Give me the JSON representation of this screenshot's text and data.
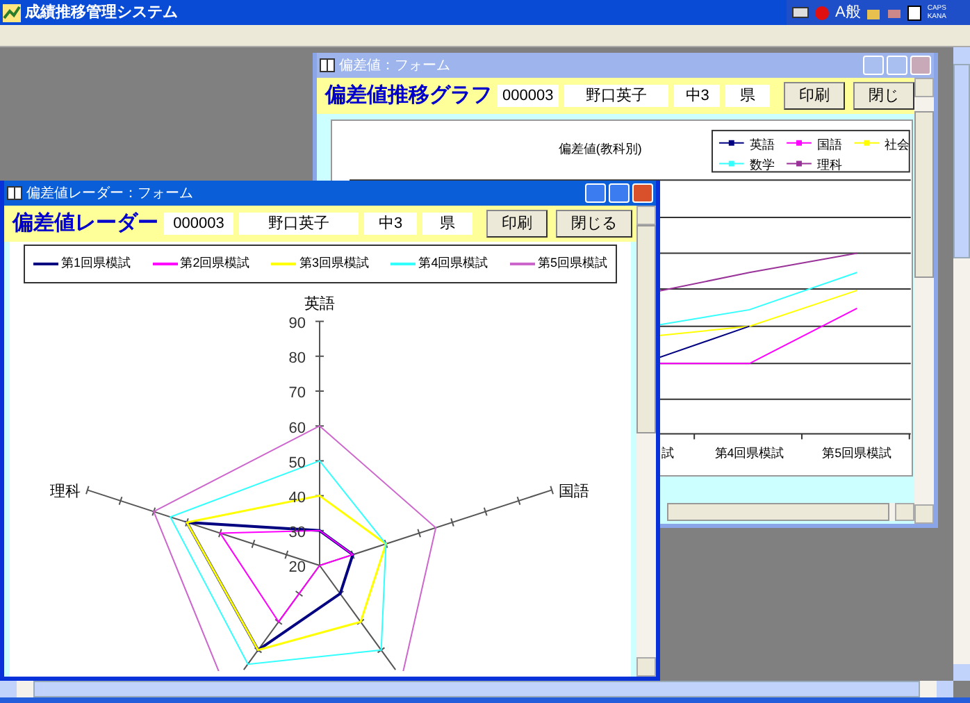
{
  "app": {
    "title": "成績推移管理システム",
    "ime_mode": "A般",
    "caps": "CAPS",
    "kana": "KANA"
  },
  "trend_window": {
    "title": "偏差値：フォーム",
    "heading": "偏差値推移グラフ",
    "fields": [
      "000003",
      "野口英子",
      "中3",
      "県"
    ],
    "buttons": [
      "印刷",
      "閉じ"
    ],
    "chart_title": "偏差値(教科別)",
    "legend": [
      {
        "label": "英語",
        "color": "#000080"
      },
      {
        "label": "国語",
        "color": "#ff00ff"
      },
      {
        "label": "社会",
        "color": "#ffff00"
      },
      {
        "label": "数学",
        "color": "#33ffff"
      },
      {
        "label": "理科",
        "color": "#993399"
      }
    ],
    "x_labels": [
      "試",
      "第4回県模試",
      "第5回県模試"
    ]
  },
  "radar_window": {
    "title": "偏差値レーダー：フォーム",
    "heading": "偏差値レーダー",
    "fields": [
      "000003",
      "野口英子",
      "中3",
      "県"
    ],
    "buttons": [
      "印刷",
      "閉じる"
    ],
    "legend": [
      {
        "label": "第1回県模試",
        "color": "#000080"
      },
      {
        "label": "第2回県模試",
        "color": "#ff00ff"
      },
      {
        "label": "第3回県模試",
        "color": "#ffff00"
      },
      {
        "label": "第4回県模試",
        "color": "#33ffff"
      },
      {
        "label": "第5回県模試",
        "color": "#cc66cc"
      }
    ],
    "axis_labels": [
      "英語",
      "国語",
      "理科"
    ],
    "ticks": [
      "90",
      "80",
      "70",
      "60",
      "50",
      "40",
      "30",
      "20"
    ]
  }
}
